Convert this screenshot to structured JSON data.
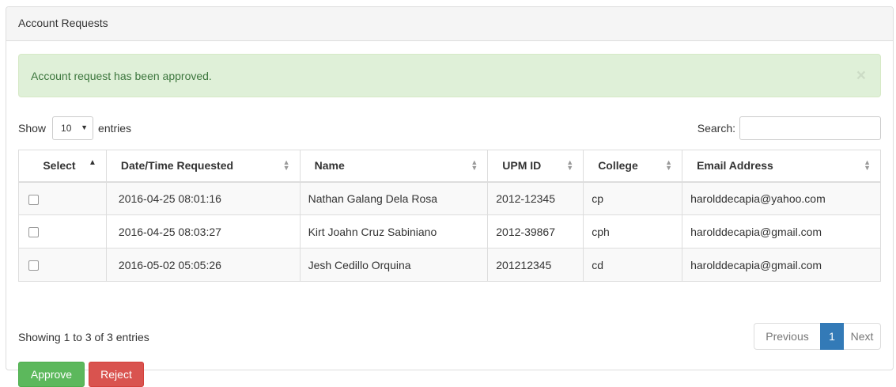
{
  "panel": {
    "title": "Account Requests"
  },
  "alert": {
    "message": "Account request has been approved.",
    "close_glyph": "×"
  },
  "length": {
    "show_label": "Show",
    "selected": "10",
    "entries_label": "entries"
  },
  "search": {
    "label": "Search:",
    "value": ""
  },
  "table": {
    "headers": [
      "Select",
      "Date/Time Requested",
      "Name",
      "UPM ID",
      "College",
      "Email Address"
    ],
    "sorted_column": "Select",
    "sort_direction": "ascending",
    "rows": [
      {
        "checked": false,
        "datetime": "2016-04-25 08:01:16",
        "name": "Nathan Galang Dela Rosa",
        "upm_id": "2012-12345",
        "college": "cp",
        "email": "harolddecapia@yahoo.com"
      },
      {
        "checked": false,
        "datetime": "2016-04-25 08:03:27",
        "name": "Kirt Joahn Cruz Sabiniano",
        "upm_id": "2012-39867",
        "college": "cph",
        "email": "harolddecapia@gmail.com"
      },
      {
        "checked": false,
        "datetime": "2016-05-02 05:05:26",
        "name": "Jesh Cedillo Orquina",
        "upm_id": "201212345",
        "college": "cd",
        "email": "harolddecapia@gmail.com"
      }
    ]
  },
  "info": "Showing 1 to 3 of 3 entries",
  "pagination": {
    "previous": "Previous",
    "current": "1",
    "next": "Next"
  },
  "actions": {
    "approve": "Approve",
    "reject": "Reject"
  },
  "colors": {
    "alert_bg": "#dff0d8",
    "alert_text": "#3c763d",
    "approve": "#5cb85c",
    "reject": "#d9534f",
    "page_active": "#337ab7"
  }
}
